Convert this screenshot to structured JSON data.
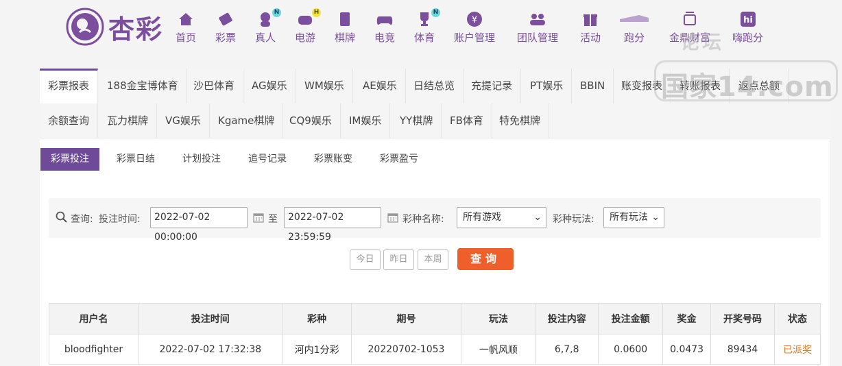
{
  "brand": {
    "name": "杏彩",
    "color": "#7b4e9e"
  },
  "nav": [
    {
      "id": "home",
      "label": "首页",
      "icon": "home-icon"
    },
    {
      "id": "lottery",
      "label": "彩票",
      "icon": "ticket-icon"
    },
    {
      "id": "live",
      "label": "真人",
      "icon": "dealer-icon",
      "badge": "N"
    },
    {
      "id": "slots",
      "label": "电游",
      "icon": "gamepad-icon",
      "badge": "H"
    },
    {
      "id": "cards",
      "label": "棋牌",
      "icon": "cards-icon"
    },
    {
      "id": "esports",
      "label": "电竞",
      "icon": "controller-icon"
    },
    {
      "id": "sports",
      "label": "体育",
      "icon": "trophy-icon",
      "badge": "N"
    },
    {
      "id": "account",
      "label": "账户管理",
      "icon": "yen-icon"
    },
    {
      "id": "team",
      "label": "团队管理",
      "icon": "team-icon"
    },
    {
      "id": "activity",
      "label": "活动",
      "icon": "gift-icon"
    },
    {
      "id": "score",
      "label": "跑分",
      "icon": "race-icon"
    },
    {
      "id": "treasure",
      "label": "金鼎财富",
      "icon": "treasure-icon"
    },
    {
      "id": "hipao",
      "label": "嗨跑分",
      "icon": "hi-icon"
    }
  ],
  "watermark": {
    "top": "论坛",
    "main": "国家14.com"
  },
  "tabs_row1": [
    "彩票报表",
    "188金宝博体育",
    "沙巴体育",
    "AG娱乐",
    "WM娱乐",
    "AE娱乐",
    "日结总览",
    "充提记录",
    "PT娱乐",
    "BBIN",
    "账变报表",
    "转账报表",
    "返点总额"
  ],
  "tabs_row2": [
    "余额查询",
    "瓦力棋牌",
    "VG娱乐",
    "Kgame棋牌",
    "CQ9娱乐",
    "IM娱乐",
    "YY棋牌",
    "FB体育",
    "特免棋牌"
  ],
  "sub_tabs": [
    "彩票投注",
    "彩票日结",
    "计划投注",
    "追号记录",
    "彩票账变",
    "彩票盈亏"
  ],
  "query": {
    "label": "查询:",
    "time_label": "投注时间:",
    "start": "2022-07-02 00:00:00",
    "to": "至",
    "end": "2022-07-02 23:59:59",
    "game_label": "彩种名称:",
    "game_value": "所有游戏",
    "play_label": "彩种玩法:",
    "play_value": "所有玩法",
    "btn_today": "今日",
    "btn_yesterday": "昨日",
    "btn_week": "本周",
    "search": "查询"
  },
  "table": {
    "headers": [
      "用户名",
      "投注时间",
      "彩种",
      "期号",
      "玩法",
      "投注内容",
      "投注金额",
      "奖金",
      "开奖号码",
      "状态"
    ],
    "rows": [
      [
        "bloodfighter",
        "2022-07-02 17:32:38",
        "河内1分彩",
        "20220702-1053",
        "一帆风顺",
        "6,7,8",
        "0.0600",
        "0.0473",
        "89434",
        "已派奖"
      ]
    ]
  }
}
